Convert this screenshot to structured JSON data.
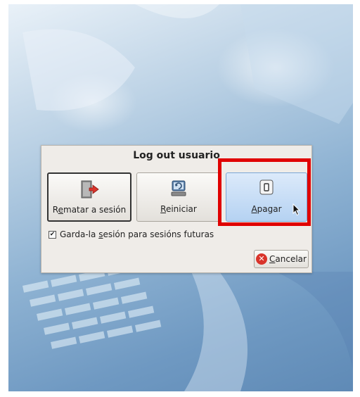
{
  "dialog": {
    "title": "Log out usuario",
    "actions": [
      {
        "label_pre": "R",
        "label_mn": "e",
        "label_post": "matar a sesión",
        "icon": "logout-door-icon"
      },
      {
        "label_pre": "",
        "label_mn": "R",
        "label_post": "einiciar",
        "icon": "restart-icon"
      },
      {
        "label_pre": "",
        "label_mn": "A",
        "label_post": "pagar",
        "icon": "power-switch-icon"
      }
    ],
    "save_session": {
      "checked": true,
      "label_pre": "Garda-la ",
      "label_mn": "s",
      "label_post": "esión para sesións futuras"
    },
    "cancel": {
      "label_mn": "C",
      "label_post": "ancelar",
      "icon": "cancel-icon"
    }
  },
  "colors": {
    "highlight": "#e00000",
    "selected_button": "#b5d2f2",
    "cancel_icon": "#d9342b"
  }
}
